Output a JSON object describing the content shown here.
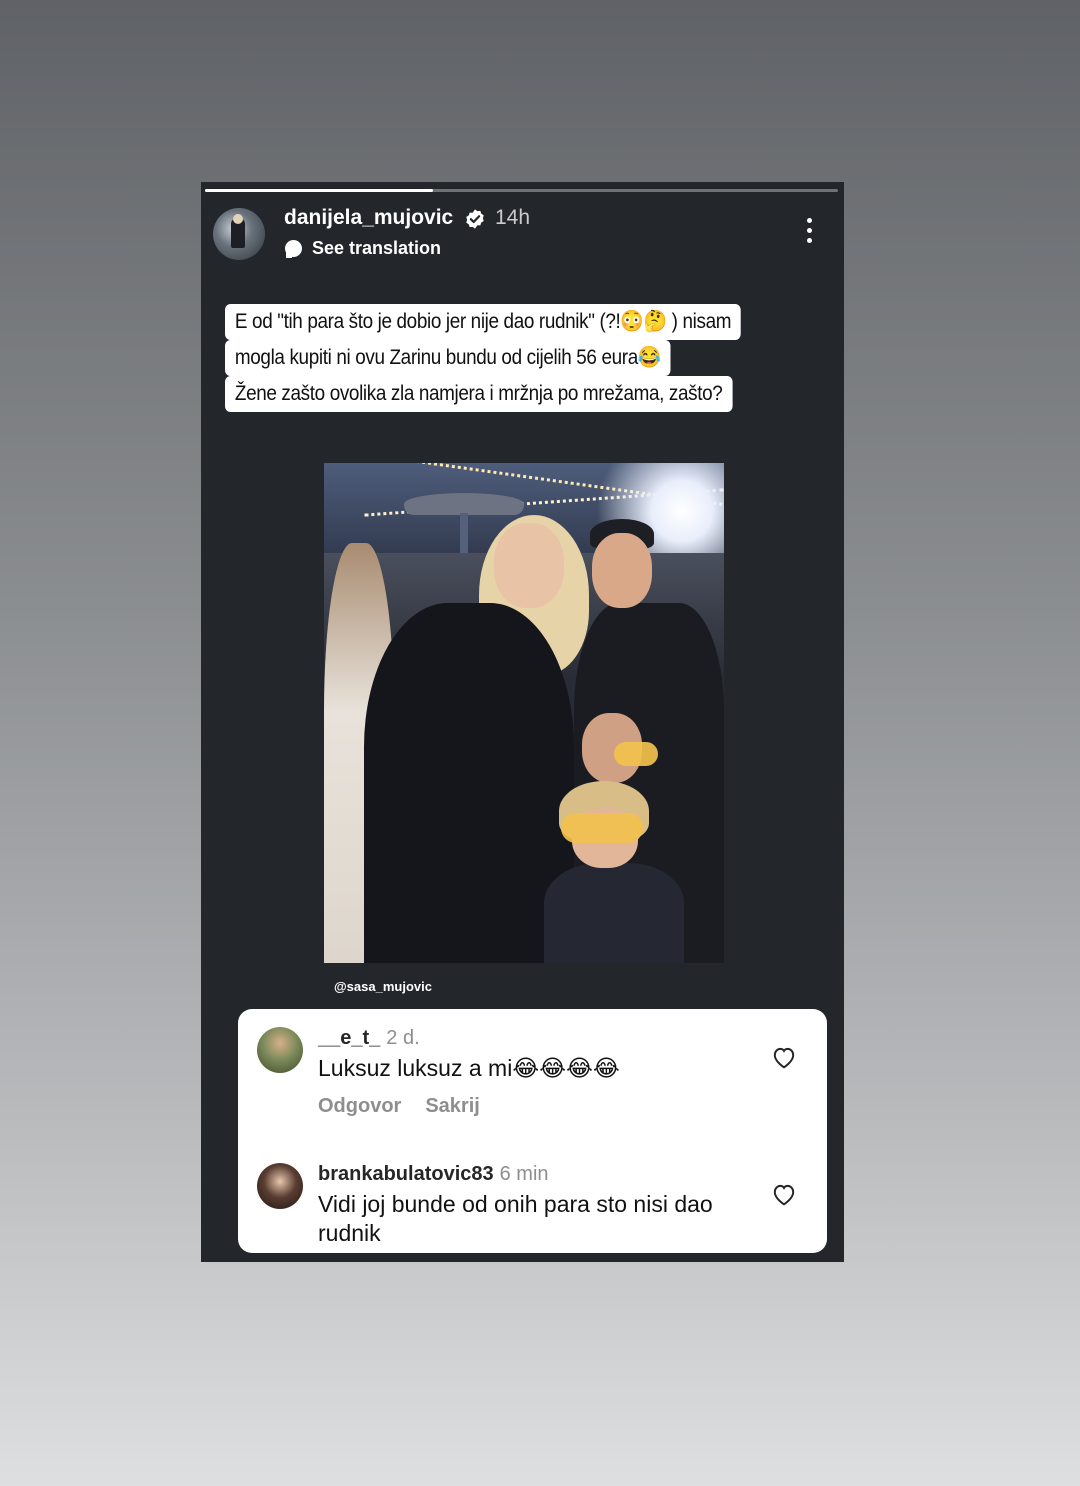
{
  "story": {
    "progress_fraction": 0.36,
    "username": "danijela_mujovic",
    "time": "14h",
    "translate_label": "See translation",
    "caption_lines": [
      "E od \"tih para što je dobio jer nije dao rudnik\" (?!😳🤔 ) nisam",
      "mogla kupiti ni ovu Zarinu bundu od cijelih 56 eura😂",
      "Žene zašto ovolika zla namjera i mržnja po mrežama, zašto?"
    ],
    "photo_tag": "@sasa_mujovic"
  },
  "comments": [
    {
      "username": "__e_t_",
      "time": "2 d.",
      "text": "Luksuz luksuz a mi😂😂😂😂",
      "reply_label": "Odgovor",
      "hide_label": "Sakrij"
    },
    {
      "username": "brankabulatovic83",
      "time": "6 min",
      "text": "Vidi joj bunde od onih para sto nisi dao rudnik"
    }
  ],
  "icons": {
    "verified": "verified-badge-icon",
    "more": "more-vertical-icon",
    "translate": "speech-bubble-icon",
    "like": "heart-outline-icon"
  },
  "colors": {
    "story_bg": "#23272b",
    "muted_text": "#8e8e8e"
  }
}
